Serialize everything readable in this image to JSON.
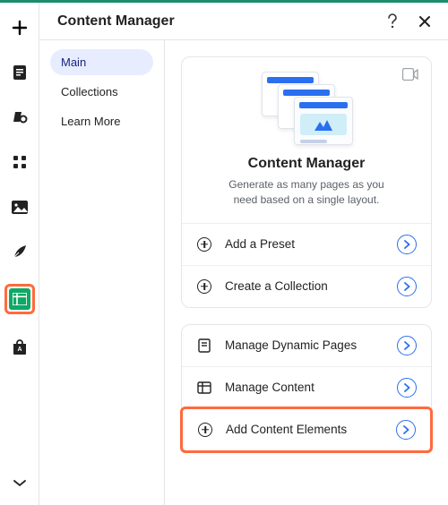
{
  "panel": {
    "title": "Content Manager"
  },
  "tabs": {
    "main": "Main",
    "collections": "Collections",
    "learn_more": "Learn More"
  },
  "hero": {
    "heading": "Content Manager",
    "subtext": "Generate as many pages as you need based on a single layout."
  },
  "actions_primary": {
    "add_preset": "Add a Preset",
    "create_collection": "Create a Collection"
  },
  "actions_secondary": {
    "manage_dynamic_pages": "Manage Dynamic Pages",
    "manage_content": "Manage Content",
    "add_content_elements": "Add Content Elements"
  }
}
